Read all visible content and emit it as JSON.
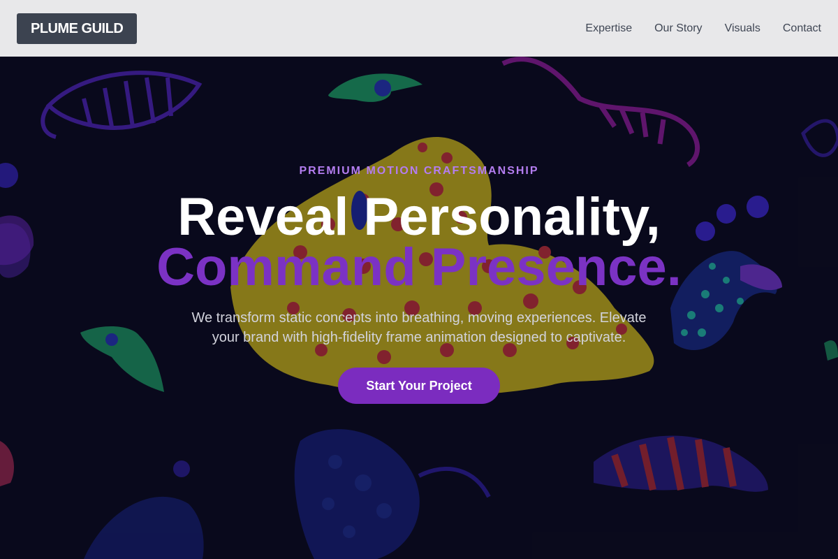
{
  "header": {
    "logo": "PLUME GUILD",
    "nav": [
      "Expertise",
      "Our Story",
      "Visuals",
      "Contact"
    ]
  },
  "hero": {
    "eyebrow": "PREMIUM MOTION CRAFTSMANSHIP",
    "headline_line1": "Reveal Personality,",
    "headline_line2": "Command Presence.",
    "subtext": "We transform static concepts into breathing, moving experiences. Elevate your brand with high-fidelity frame animation designed to captivate.",
    "cta_label": "Start Your Project"
  },
  "colors": {
    "nav_bg": "#e8e8ea",
    "logo_bg": "#3c4350",
    "hero_bg": "#0b0b1e",
    "accent": "#7b2cbf",
    "eyebrow": "#b47df0"
  }
}
